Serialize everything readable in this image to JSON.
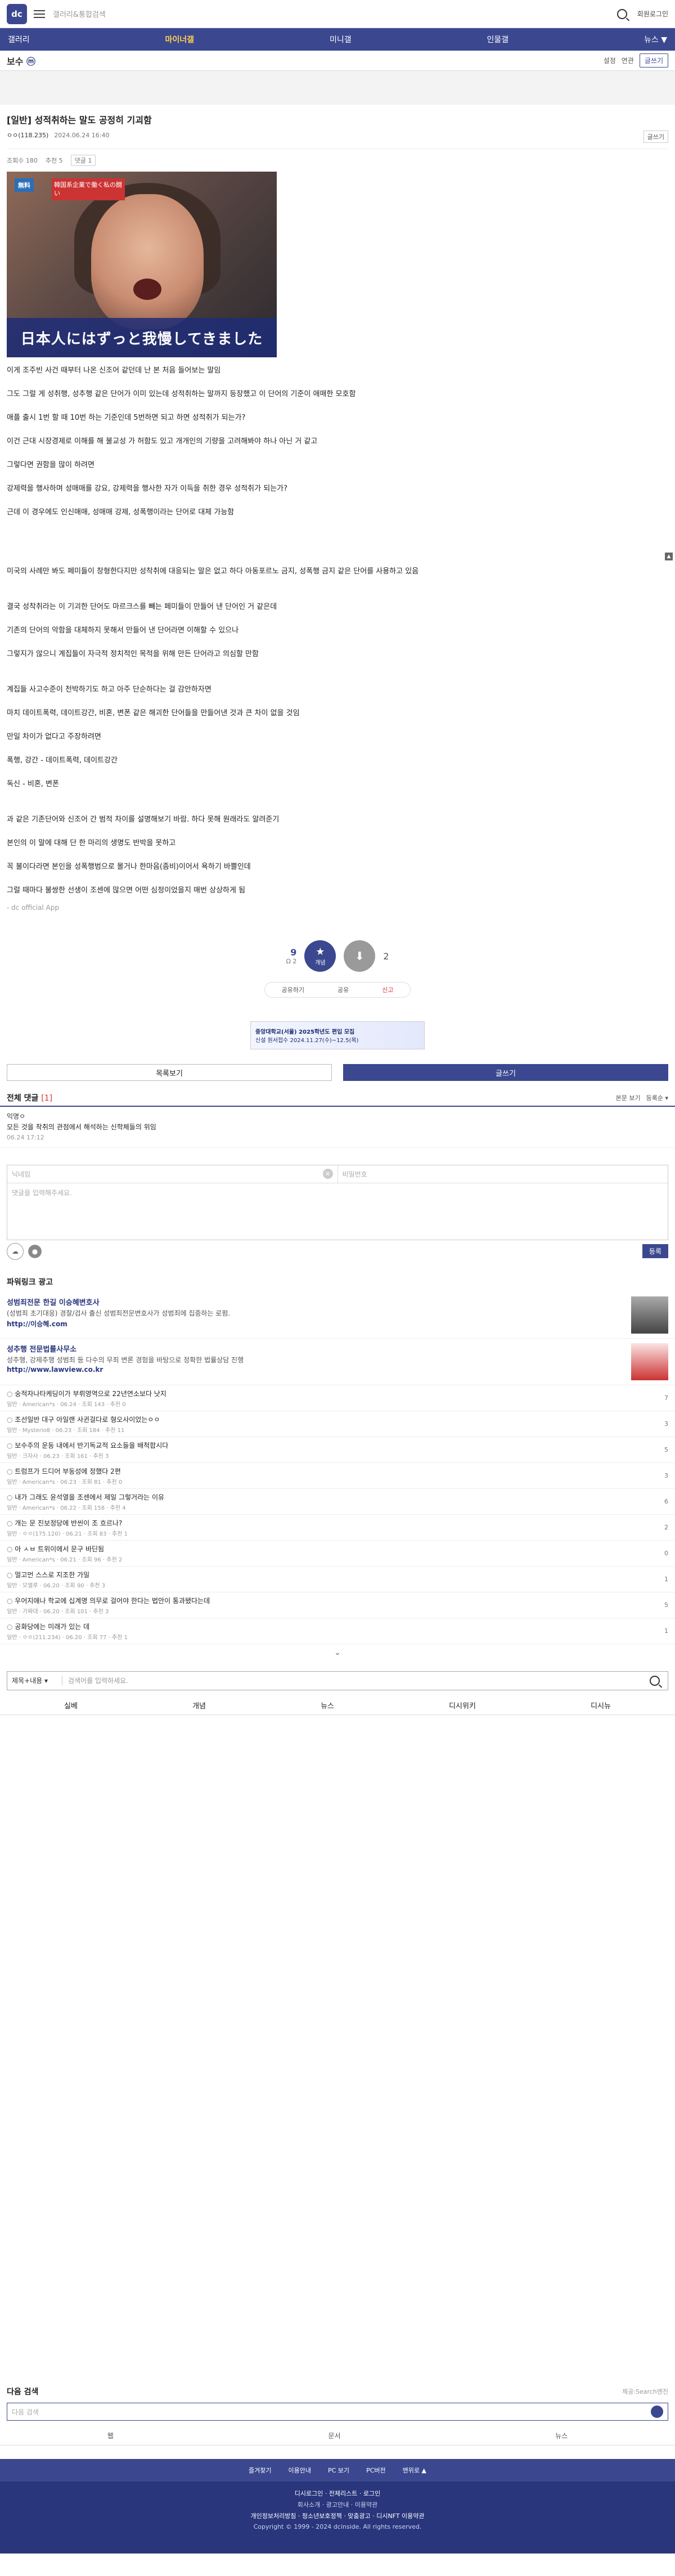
{
  "header": {
    "logo": "dc",
    "search_placeholder": "갤러리&통합검색",
    "login": "회원로그인"
  },
  "gnb": [
    "갤러리",
    "마이너갤",
    "미니갤",
    "인물갤",
    "뉴스 ▼"
  ],
  "gallery": {
    "name": "보수",
    "name_mark": "ⓜ",
    "tools": [
      "설정",
      "연관"
    ],
    "write": "글쓰기"
  },
  "article": {
    "title": "[일반] 성적취하는 말도 공정히 기괴함",
    "author": "ㅇㅇ(118.235)",
    "date": "2024.06.24 16:40",
    "copy": "글쓰기",
    "views": "조회수 180",
    "recommends": "추천 5",
    "tag": "댓글 1",
    "image": {
      "badge": "無料",
      "blurb": "韓国系企業で働く私の闘い",
      "caption": "日本人にはずっと我慢してきました"
    },
    "paragraphs": [
      "이게 조주빈 사건 때부터 나온 신조어 같던데 난 본 처음 들어보는 말임",
      "",
      "그도 그럴 게 성취행, 성추행 같은 단어가 이미 있는데 성적취하는 말까지 등장했고 이 단어의 기준이 애매한 모호함",
      "",
      "애플 출시 1번 할 때 10번 하는 기준인데 5번하면 되고 하면 성적취가 되는가?",
      "",
      "이건 근대 시장경제로 이해를 해 불교성 가 허함도 있고 개개인의 기량을 고려해봐야 하나 아닌 거 같고",
      "",
      "그렇다면 권함을 많이 하려면",
      "",
      "강제력을 행사하며 성매매를 강요, 강제력을 행사한 자가 이득을 취한 경우 성적취가 되는가?",
      "",
      "근데 이 경우에도 인신매매, 성매매 강제, 성폭행이라는 단어로 대체 가능함",
      "",
      "",
      "",
      "",
      "미국의 사례만 봐도 페미들이 창형한다지만 성착취에 대응되는 말은 없고 하다 아동포르노 금지, 성폭행 금지 같은 단어를 사용하고 있음",
      "",
      "",
      "결국 성착취라는 이 기괴한 단어도 마르크스를 빼는 페미들이 만들어 낸 단어인 거 같은데",
      "",
      "기존의 단어의 악함을 대체하지 못해서 만들어 낸 단어라면 이해할 수 있으나",
      "",
      "그렇지가 않으니 계집들이 자극적 정치적인 목적을 위해 만든 단어라고 의심할 만함",
      "",
      "",
      "계집들 사고수준이 천박하기도 하고 아주 단순하다는 걸 감안하자면",
      "",
      "마치 데이트폭력, 데이트강간, 비혼, 변폰 같은 해괴한 단어들을 만들어낸 것과 큰 차이 없을 것임",
      "",
      "만일 차이가 없다고 주장하려면",
      "",
      "폭행, 강간 - 데이트폭력, 데이트강간",
      "",
      "독신 - 비혼, 변폰",
      "",
      "",
      "과 같은 기존단어와 신조어 간 범적 차이를 설명해보기 바람. 하다 못해 원래라도 알려준기",
      "",
      "본인의 이 말에 대해 단 한 마리의 생명도 반박을 못하고",
      "",
      "꼭 볼이다라면 본인을 성폭행범으로 몰거나 한마음(좀비)이어서 욕하기 바쁠인데",
      "",
      "그럴 때마다 불쌍한 선생이 조센에 많으면 어떤 심정이었을지 매번 상상하게 됨"
    ],
    "source": "- dc official App"
  },
  "recommend": {
    "up_count": "9",
    "up_sub": "Ω 2",
    "up_label": "개념",
    "down_count": "2"
  },
  "share": [
    "공유하기",
    "공유",
    "신고"
  ],
  "banner": {
    "text": "중앙대학교(서울) 2025학년도 편입 모집",
    "sub": "신설 원서접수 2024.11.27(수)~12.5(목)"
  },
  "nav": {
    "list": "목록보기",
    "write": "글쓰기"
  },
  "comments": {
    "title": "전체 댓글",
    "count": "[1]",
    "sort1": "본문 보기",
    "sort2": "등록순 ▾",
    "items": [
      {
        "nick": "익명ㅇ",
        "text": "모든 것을 착취의 관점에서 해석하는 신학체들의 위임",
        "date": "06.24 17:12"
      }
    ],
    "form": {
      "nick": "닉네임",
      "pw": "비밀번호",
      "placeholder": "댓글을 입력해주세요.",
      "submit": "등록"
    }
  },
  "powerlink": {
    "title": "파워링크 광고",
    "ads": [
      {
        "t1": "성범죄전문 한길 이승혜변호사",
        "t2": "(성범죄 초기대응) 경찰/검사 출신 성범죄전문변호사가 성범죄에 집중하는 로펌.",
        "t3": "http://이승혜.com"
      },
      {
        "t1": "성추행 전문법률사무소",
        "t2": "성추행, 강제추행 성범죄 등 다수의 무죄 변론 경험을 바탕으로 정확한 법률상담 진행",
        "t3": "http://www.lawview.co.kr"
      }
    ]
  },
  "posts": [
    {
      "title": "숭적자나타케딩이가 부뤼영역으로 22년연소보다 낫지",
      "meta": "일반 · American*s · 06.24 · 조회 143 · 추천 0",
      "c": "7"
    },
    {
      "title": "조선일반 대구 아일랜 사귄걸다로 형오사이었는ㅇㅇ",
      "meta": "일반 · Mysterio8 · 06.23 · 조회 184 · 추천 11",
      "c": "3"
    },
    {
      "title": "보수주의 운동 내에서 반기독교적 요소들을 배척합시다",
      "meta": "일반 · 크자사 · 06.23 · 조회 161 · 추천 3",
      "c": "5"
    },
    {
      "title": "트럼프가 드디어 부동성에 정했다 2편",
      "meta": "일반 · American*s · 06.23 · 조회 81 · 추천 0",
      "c": "3"
    },
    {
      "title": "내가 그래도 윤석열을 조센에서 제일 그렇거라는 이유",
      "meta": "일반 · American*s · 06.22 · 조회 158 · 추천 4",
      "c": "6"
    },
    {
      "title": "개는 문 진보정당에 반씬이 조 흐르나?",
      "meta": "일반 · ㅇㅇ(175.120) · 06.21 · 조회 83 · 추천 1",
      "c": "2"
    },
    {
      "title": "아 ㅅㅂ 트위이에서 문구 바딘됨",
      "meta": "일반 · American*s · 06.21 · 조회 96 · 추천 2",
      "c": "0"
    },
    {
      "title": "멀고먼 스스로 지조한 가밀",
      "meta": "일반 · 모엘루 · 06.20 · 조회 90 · 추천 3",
      "c": "1"
    },
    {
      "title": "우어지애나 학교에 십계명 의무로 걸어야 한다는 법안이 통과됐다는데",
      "meta": "일반 · 가짜대 · 06.20 · 조회 101 · 추천 3",
      "c": "5"
    },
    {
      "title": "공화당에는 미래가 있는 데",
      "meta": "일반 · ㅇㅇ(211.234) · 06.20 · 조회 77 · 추천 1",
      "c": "1"
    }
  ],
  "bottom_search": {
    "select": "제목+내용 ▾",
    "placeholder": "검색어를 입력하세요."
  },
  "bottom_tabs": [
    "실베",
    "개념",
    "뉴스",
    "디시위키",
    "디시뉴"
  ],
  "next_search": {
    "title": "다음 검색",
    "right": "제공:Search엔진",
    "placeholder": "다음 검색",
    "tabs": [
      "웹",
      "문서",
      "뉴스"
    ]
  },
  "footer": {
    "links1": [
      "즐겨찾기",
      "이용안내",
      "PC 보기",
      "PC버전",
      "맨위로 ▲"
    ],
    "links2": "디시로그인 · 전체리스트 · 로그인",
    "links3": "회사소개 · 광고안내 · 이용약관",
    "links4": "개인정보처리방침 · 청소년보호정책 · 맞춤광고 · 디시NFT 이용약관",
    "copyright": "Copyright © 1999 - 2024 dcinside. All rights reserved."
  }
}
